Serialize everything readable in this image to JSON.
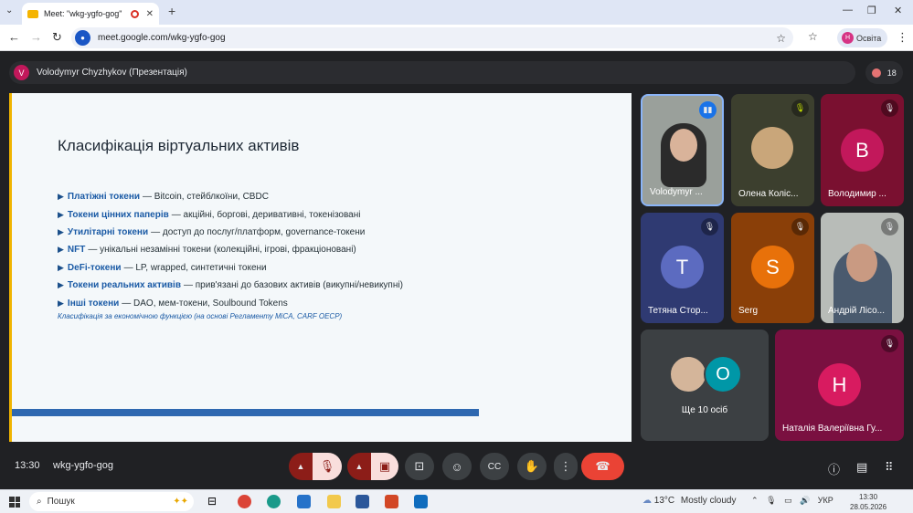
{
  "browser": {
    "tab_title": "Meet: \"wkg-ygfo-gog\"",
    "url": "meet.google.com/wkg-ygfo-gog",
    "profile_label": "Освіта",
    "profile_initial": "H"
  },
  "presenter": {
    "initial": "V",
    "label": "Volodymyr Chyzhykov (Презентація)"
  },
  "participants_count": "18",
  "slide": {
    "title": "Класифікація віртуальних активів",
    "bullets": [
      {
        "term": "Платіжні токени",
        "rest": "— Bitcoin, стейблкоїни, CBDC"
      },
      {
        "term": "Токени цінних паперів",
        "rest": "— акційні, боргові, деривативні, токенізовані"
      },
      {
        "term": "Утилітарні токени",
        "rest": "— доступ до послуг/платформ, governance-токени"
      },
      {
        "term": "NFT",
        "rest": "— унікальні незамінні токени (колекційні, ігрові, фракціоновані)"
      },
      {
        "term": "DeFi-токени",
        "rest": "— LP, wrapped, синтетичні токени"
      },
      {
        "term": "Токени реальних активів",
        "rest": "— прив'язані до базових активів (викупні/невикупні)"
      },
      {
        "term": "Інші токени",
        "rest": "— DAO, мем-токени, Soulbound Tokens"
      }
    ],
    "note": "Класифікація за економічною функцією (на основі Регламенту MiCA, CARF OECP)"
  },
  "tiles": [
    {
      "name": "Volodymyr ...",
      "initial": ""
    },
    {
      "name": "Олена Коліс...",
      "initial": ""
    },
    {
      "name": "Володимир ...",
      "initial": "B"
    },
    {
      "name": "Тетяна Стор...",
      "initial": "T"
    },
    {
      "name": "Serg",
      "initial": "S"
    },
    {
      "name": "Андрій Лісо...",
      "initial": ""
    },
    {
      "name": "Ще 10 осіб",
      "initial": "O"
    },
    {
      "name": "Наталія Валеріївна Гу...",
      "initial": "H"
    }
  ],
  "bottom": {
    "time": "13:30",
    "meeting_code": "wkg-ygfo-gog"
  },
  "taskbar": {
    "search": "Пошук",
    "temp": "13°C",
    "weather": "Mostly cloudy",
    "lang": "УКР",
    "time": "13:30",
    "date": "28.05.2026"
  },
  "colors": {
    "tile_b": "#c2185b",
    "tile_t": "#5c6bc0",
    "tile_s": "#e8710a",
    "tile_o": "#0097a7",
    "tile_h": "#d81b60",
    "end_call": "#ea4335",
    "muted_btn": "#f9dedc"
  }
}
